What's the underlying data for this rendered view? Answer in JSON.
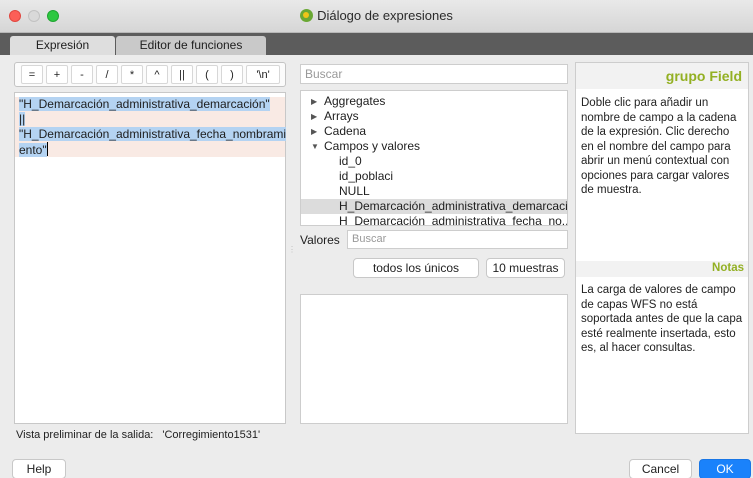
{
  "window": {
    "title": "Diálogo de expresiones"
  },
  "tabs": [
    {
      "label": "Expresión"
    },
    {
      "label": "Editor de funciones"
    }
  ],
  "operators": [
    "=",
    "+",
    "-",
    "/",
    "*",
    "^",
    "||",
    "(",
    ")",
    "'\\n'"
  ],
  "editor": {
    "lines": [
      "\"H_Demarcación_administrativa_demarcación\"",
      "||",
      "\"H_Demarcación_administrativa_fecha_nombrami",
      "ento\""
    ]
  },
  "preview": {
    "label": "Vista preliminar de la salida:",
    "value": "'Corregimiento1531'"
  },
  "function_search": {
    "placeholder": "Buscar"
  },
  "function_tree": {
    "groups": [
      {
        "label": "Aggregates",
        "expanded": false
      },
      {
        "label": "Arrays",
        "expanded": false
      },
      {
        "label": "Cadena",
        "expanded": false
      },
      {
        "label": "Campos y valores",
        "expanded": true
      }
    ],
    "children": [
      "id_0",
      "id_poblaci",
      "NULL",
      "H_Demarcación_administrativa_demarcaci...",
      "H_Demarcación_administrativa_fecha_no..."
    ],
    "selected_child_index": 3
  },
  "values": {
    "label": "Valores",
    "search_placeholder": "Buscar",
    "all_unique_button": "todos los únicos",
    "sample_button": "10 muestras"
  },
  "help": {
    "title": "grupo Field",
    "text": "Doble clic para añadir un nombre de campo a la cadena de la expresión. Clic derecho en el nombre del campo para abrir un menú contextual con opciones para cargar valores de muestra.",
    "notes_title": "Notas",
    "notes_text": "La carga de valores de campo de capas WFS no está soportada antes de que la capa esté realmente insertada, esto es, al hacer consultas."
  },
  "footer": {
    "help_button": "Help",
    "cancel_button": "Cancel",
    "ok_button": "OK"
  },
  "colors": {
    "accent": "#1a82fb",
    "help_title": "#93b023",
    "editor_highlight": "#b4d3f2"
  }
}
